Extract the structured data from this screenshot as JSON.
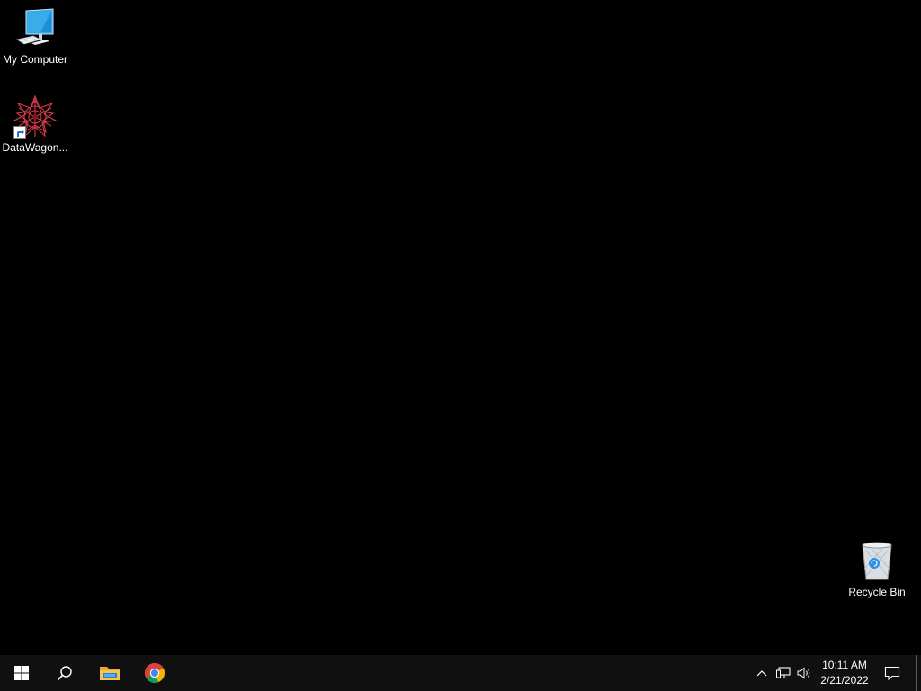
{
  "desktop": {
    "background": "#000000",
    "icons": [
      {
        "label": "My Computer",
        "icon": "computer-icon"
      },
      {
        "label": "DataWagon...",
        "icon": "datawagon-app-icon",
        "shortcut": true
      },
      {
        "label": "Recycle Bin",
        "icon": "recycle-bin-icon"
      }
    ]
  },
  "taskbar": {
    "background": "#101010",
    "start_icon": "windows-logo-icon",
    "search_icon": "search-icon",
    "pinned": [
      {
        "name": "File Explorer",
        "icon": "folder-icon"
      },
      {
        "name": "Google Chrome",
        "icon": "chrome-icon"
      }
    ],
    "tray": {
      "icons": [
        "chevron-up-icon",
        "network-icon",
        "volume-icon"
      ],
      "time": "10:11 AM",
      "date": "2/21/2022",
      "notification_icon": "notification-icon"
    }
  }
}
